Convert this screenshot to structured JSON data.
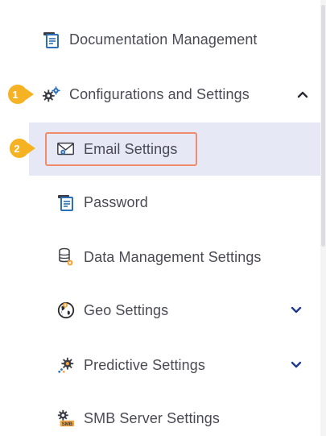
{
  "menu": {
    "items": [
      {
        "label": "Documentation Management",
        "icon": "document-folder-icon"
      },
      {
        "label": "Configurations and Settings",
        "icon": "gears-icon",
        "expanded": true
      },
      {
        "label": "Email Settings",
        "icon": "email-settings-icon",
        "selected": true
      },
      {
        "label": "Password",
        "icon": "document-folder-icon"
      },
      {
        "label": "Data Management Settings",
        "icon": "database-icon"
      },
      {
        "label": "Geo Settings",
        "icon": "globe-icon",
        "expanded": false
      },
      {
        "label": "Predictive Settings",
        "icon": "predictive-icon",
        "expanded": false
      },
      {
        "label": "SMB Server Settings",
        "icon": "smb-icon"
      }
    ]
  },
  "steps": [
    "1",
    "2"
  ],
  "colors": {
    "accent": "#f08c6a",
    "badge": "#f5b323",
    "selected_bg": "#e6e8f5",
    "text": "#4a4a55",
    "icon_blue": "#2a6fb8",
    "icon_dark": "#3c3c46"
  }
}
